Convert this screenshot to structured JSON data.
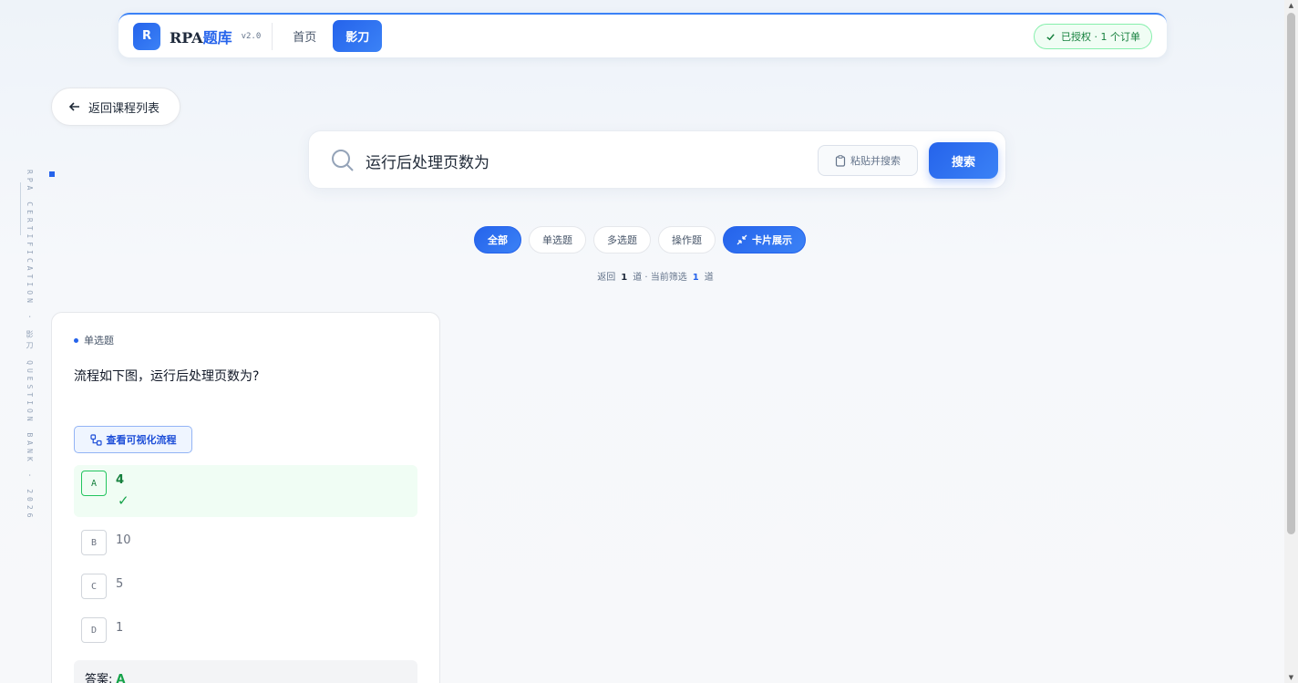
{
  "header": {
    "logo_letter": "R",
    "brand_main": "RPA",
    "brand_hl": "题库",
    "version": "v2.0",
    "nav": [
      {
        "label": "首页",
        "active": false
      },
      {
        "label": "影刀",
        "active": true
      }
    ],
    "license": "已授权 · 1 个订单"
  },
  "back_label": "返回课程列表",
  "side_text": "RPA CERTIFICATION · 影刀 QUESTION BANK · 2026",
  "search": {
    "value": "运行后处理页数为",
    "paste_label": "粘贴并搜索",
    "button_label": "搜索"
  },
  "filters": [
    {
      "label": "全部",
      "active": true
    },
    {
      "label": "单选题",
      "active": false
    },
    {
      "label": "多选题",
      "active": false
    },
    {
      "label": "操作题",
      "active": false
    }
  ],
  "view_toggle_label": "卡片展示",
  "stats": {
    "prefix": "返回",
    "returned": "1",
    "mid": "道 · 当前筛选",
    "filtered": "1",
    "suffix": "道"
  },
  "card": {
    "type": "单选题",
    "question": "流程如下图，运行后处理页数为?",
    "flow_button": "查看可视化流程",
    "options": [
      {
        "letter": "A",
        "text": "4",
        "correct": true
      },
      {
        "letter": "B",
        "text": "10",
        "correct": false
      },
      {
        "letter": "C",
        "text": "5",
        "correct": false
      },
      {
        "letter": "D",
        "text": "1",
        "correct": false
      }
    ],
    "check_mark": "✓",
    "answer_label": "答案:",
    "answer_value": "A"
  },
  "colors": {
    "accent": "#2563eb",
    "success": "#16a34a"
  }
}
